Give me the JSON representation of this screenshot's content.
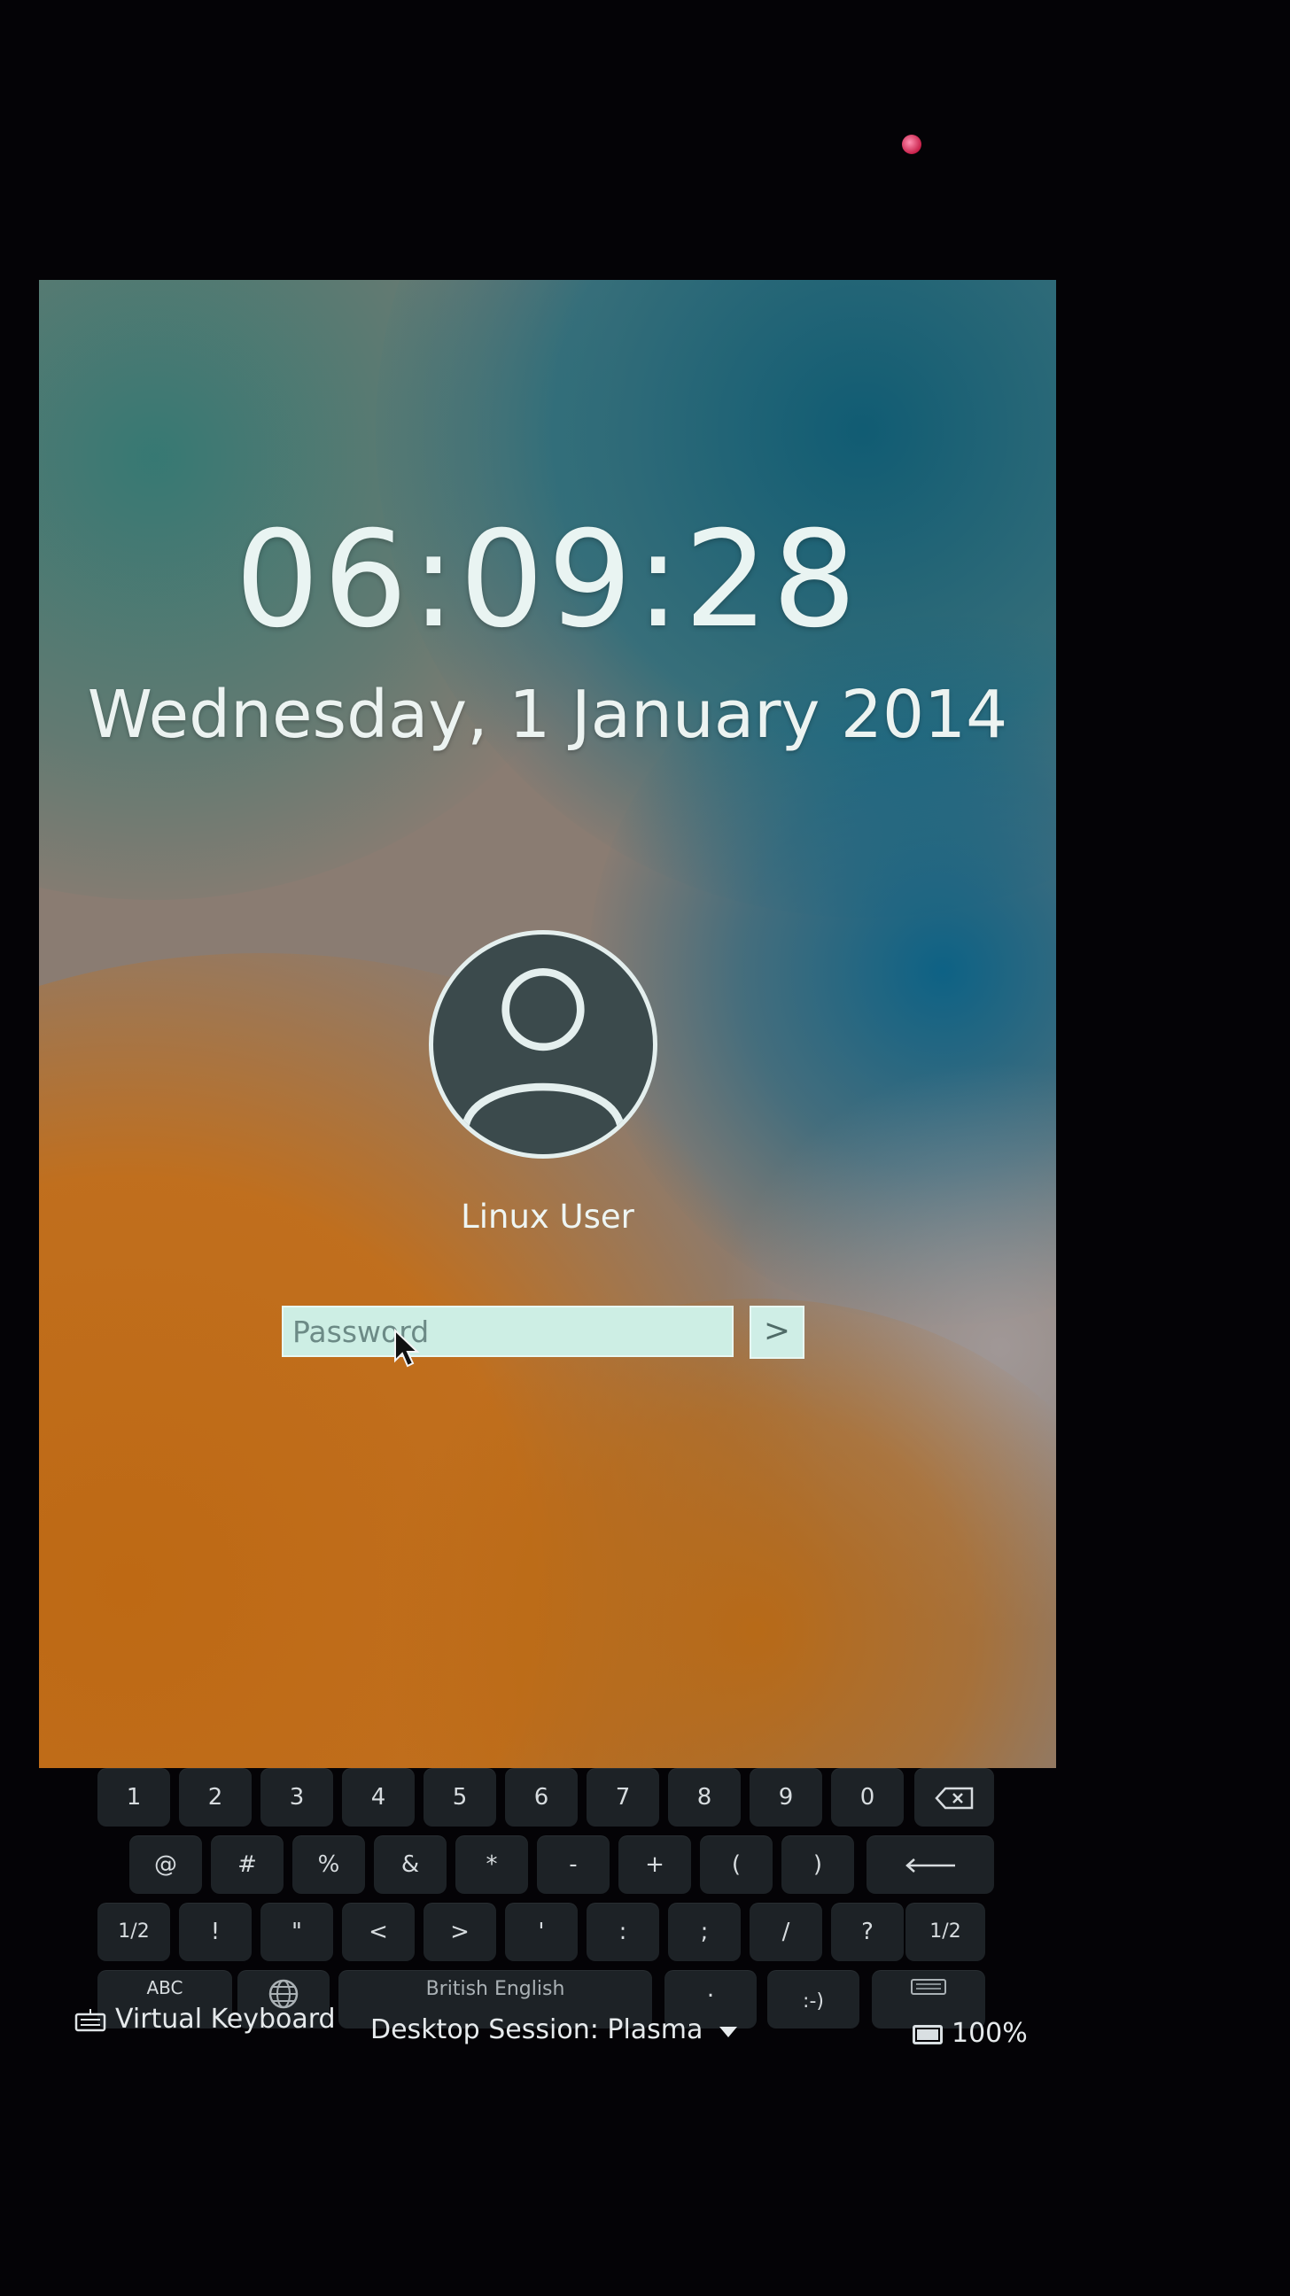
{
  "lock_screen": {
    "time": "06:09:28",
    "date": "Wednesday, 1 January 2014",
    "user_name": "Linux User",
    "password_placeholder": "Password",
    "login_button_glyph": ">"
  },
  "keyboard": {
    "row1": [
      "1",
      "2",
      "3",
      "4",
      "5",
      "6",
      "7",
      "8",
      "9",
      "0"
    ],
    "row2": [
      "@",
      "#",
      "%",
      "&",
      "*",
      "-",
      "+",
      "(",
      ")"
    ],
    "row3": [
      "1/2",
      "!",
      "\"",
      "<",
      ">",
      "'",
      ":",
      ";",
      "/",
      "?",
      "1/2"
    ],
    "row4": {
      "abc": "ABC",
      "language": "British English",
      "period": ".",
      "smiley": ":-)"
    }
  },
  "bottom_bar": {
    "virtual_keyboard_label": "Virtual Keyboard",
    "session_label": "Desktop Session: Plasma",
    "battery_label": "100%"
  },
  "colors": {
    "background": "#040306",
    "key_bg": "#1d2226",
    "input_bg": "#cdeee4",
    "text_light": "#eef5f3"
  },
  "icons": [
    "user-avatar-icon",
    "arrow-right-icon",
    "backspace-icon",
    "enter-icon",
    "globe-icon",
    "hide-keyboard-icon",
    "keyboard-icon",
    "dropdown-caret-icon",
    "battery-icon",
    "mouse-cursor-icon"
  ]
}
